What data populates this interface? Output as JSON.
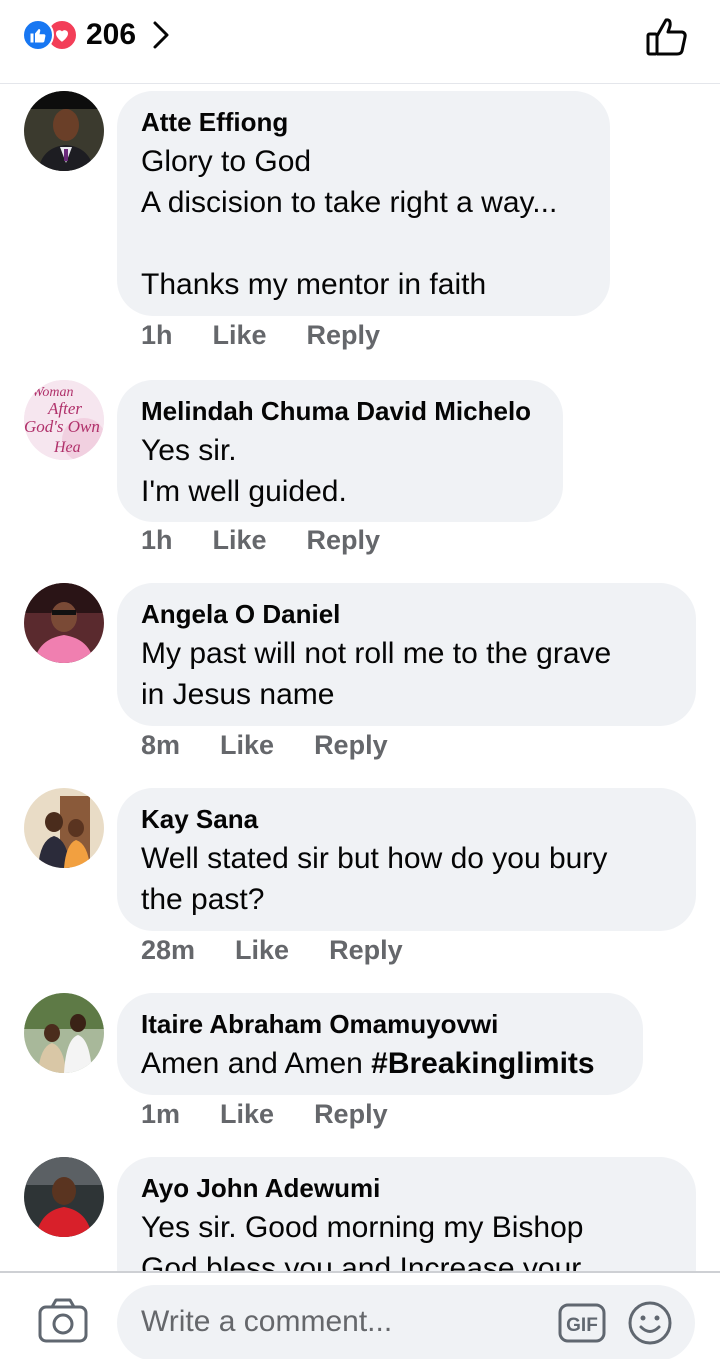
{
  "header": {
    "reaction_count": "206",
    "icons": [
      "like-reaction-icon",
      "love-reaction-icon",
      "chevron-right-icon",
      "thumbs-up-icon"
    ],
    "colors": {
      "like": "#1877f2",
      "love": "#f33e58"
    }
  },
  "comments": [
    {
      "author": "Atte Effiong",
      "text": "Glory to God\nA discision to take right a way...\n\nThanks my mentor in faith",
      "time": "1h",
      "like": "Like",
      "reply": "Reply"
    },
    {
      "author": "Melindah Chuma David Michelo",
      "text": "Yes sir.\nI'm well guided.",
      "time": "1h",
      "like": "Like",
      "reply": "Reply",
      "avatar_text": [
        "Woman",
        "After",
        "God's Own",
        "Hea"
      ]
    },
    {
      "author": "Angela O Daniel",
      "text": "My past will not roll me to the grave\nin Jesus name",
      "time": "8m",
      "like": "Like",
      "reply": "Reply"
    },
    {
      "author": "Kay Sana",
      "text": "Well stated sir but how do you bury\nthe past?",
      "time": "28m",
      "like": "Like",
      "reply": "Reply"
    },
    {
      "author": "Itaire Abraham Omamuyovwi",
      "text_plain": "Amen and Amen ",
      "text_bold": "#Breakinglimits",
      "time": "1m",
      "like": "Like",
      "reply": "Reply"
    },
    {
      "author": "Ayo John Adewumi",
      "text": "Yes sir. Good morning my Bishop\nGod bless you and Increase your"
    }
  ],
  "footer": {
    "placeholder": "Write a comment...",
    "gif_label": "GIF",
    "icons": [
      "camera-icon",
      "gif-icon",
      "emoji-icon"
    ]
  }
}
